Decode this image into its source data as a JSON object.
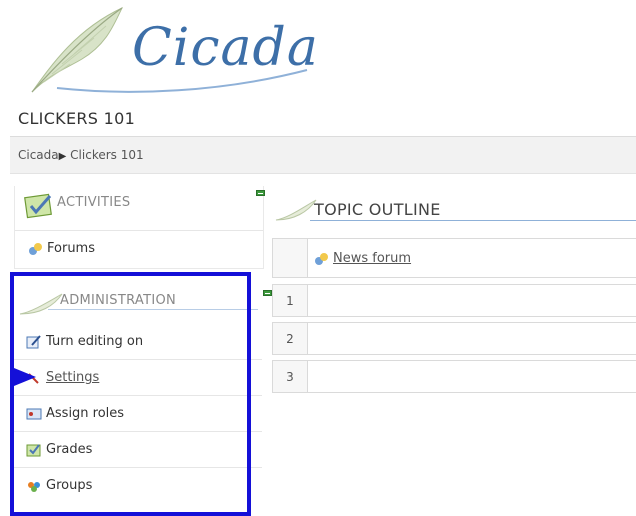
{
  "logo": {
    "text": "Cicada"
  },
  "course": {
    "title": "CLICKERS 101"
  },
  "breadcrumb": {
    "home": "Cicada",
    "separator": "▶",
    "current": "Clickers 101"
  },
  "activities": {
    "title": "ACTIVITIES",
    "items": [
      {
        "label": "Forums",
        "icon": "forum-icon"
      }
    ]
  },
  "administration": {
    "title": "ADMINISTRATION",
    "items": [
      {
        "label": "Turn editing on",
        "icon": "edit-icon"
      },
      {
        "label": "Settings",
        "icon": "settings-icon"
      },
      {
        "label": "Assign roles",
        "icon": "roles-icon"
      },
      {
        "label": "Grades",
        "icon": "grades-icon"
      },
      {
        "label": "Groups",
        "icon": "groups-icon"
      }
    ]
  },
  "topic_outline": {
    "title": "TOPIC OUTLINE",
    "sections": [
      {
        "number": "",
        "content": "News forum"
      },
      {
        "number": "1",
        "content": ""
      },
      {
        "number": "2",
        "content": ""
      },
      {
        "number": "3",
        "content": ""
      }
    ]
  },
  "colors": {
    "highlight": "#1410d8",
    "link": "#555555",
    "accent": "#3d6fa8"
  }
}
